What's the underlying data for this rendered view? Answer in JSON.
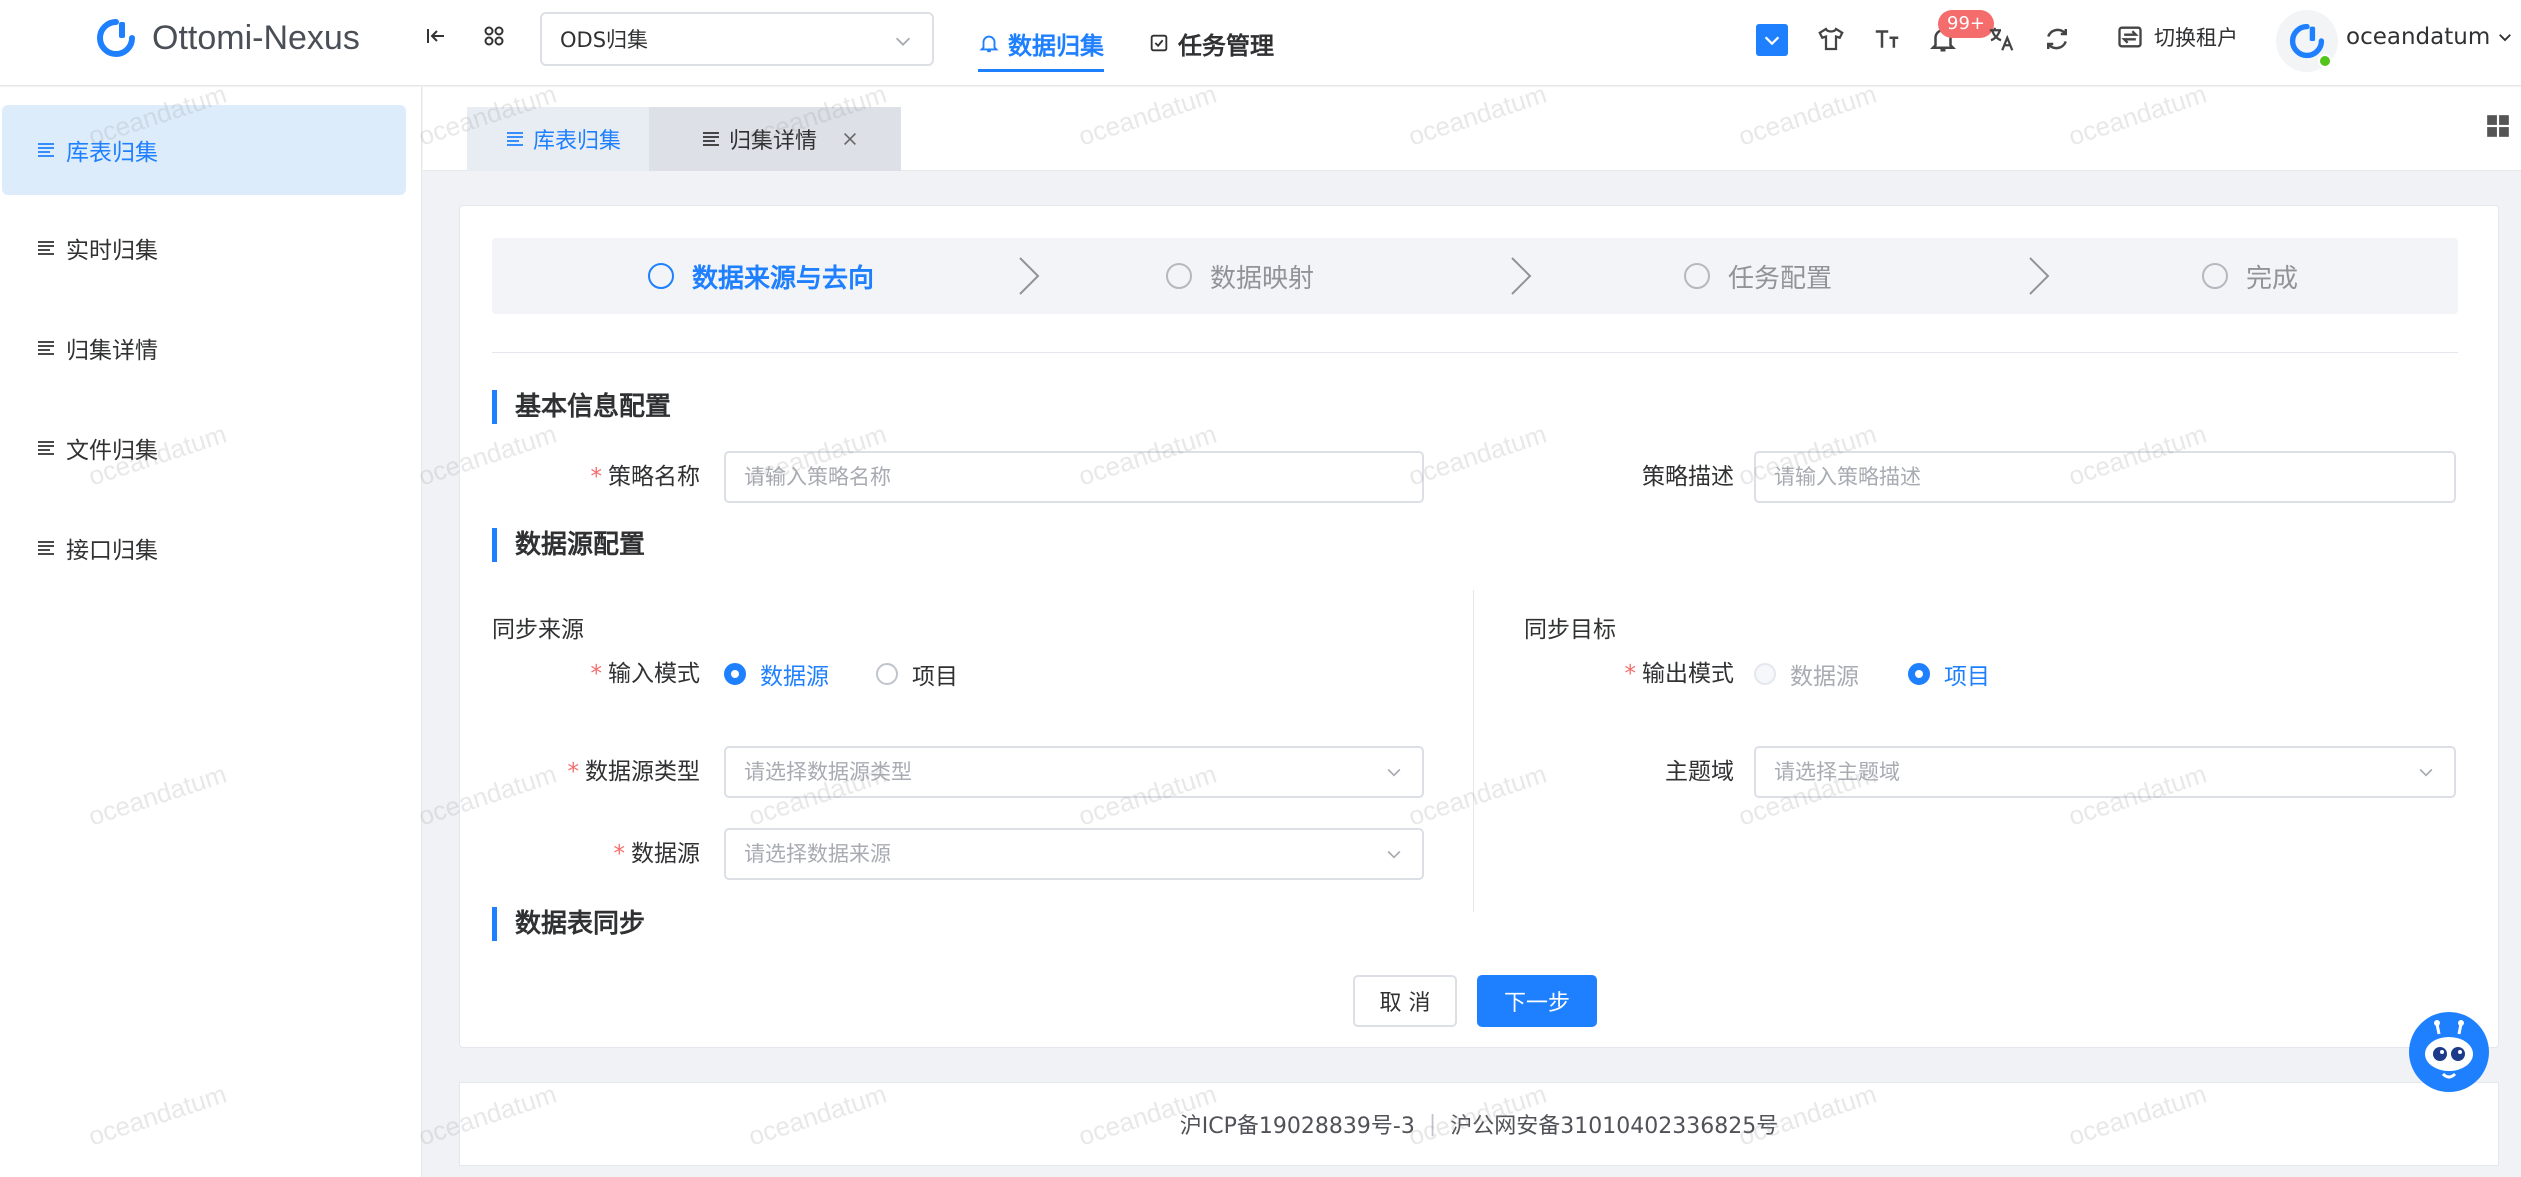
{
  "app": {
    "title": "Ottomi-Nexus"
  },
  "header": {
    "datasource_select": "ODS归集",
    "nav": [
      {
        "label": "数据归集",
        "active": true
      },
      {
        "label": "任务管理",
        "active": false
      }
    ],
    "notification_badge": "99+",
    "tenant_switch": "切换租户",
    "username": "oceandatum"
  },
  "sidebar": {
    "items": [
      {
        "label": "库表归集",
        "active": true
      },
      {
        "label": "实时归集"
      },
      {
        "label": "归集详情"
      },
      {
        "label": "文件归集"
      },
      {
        "label": "接口归集"
      }
    ]
  },
  "tabs": [
    {
      "label": "库表归集",
      "active": true
    },
    {
      "label": "归集详情",
      "closable": true
    }
  ],
  "steps": [
    {
      "label": "数据来源与去向",
      "active": true
    },
    {
      "label": "数据映射"
    },
    {
      "label": "任务配置"
    },
    {
      "label": "完成"
    }
  ],
  "form": {
    "basic_title": "基本信息配置",
    "policy_name_label": "策略名称",
    "policy_name_placeholder": "请输入策略名称",
    "policy_desc_label": "策略描述",
    "policy_desc_placeholder": "请输入策略描述",
    "datasource_title": "数据源配置",
    "source": {
      "title": "同步来源",
      "input_mode_label": "输入模式",
      "options": [
        "数据源",
        "项目"
      ],
      "selected": "数据源",
      "ds_type_label": "数据源类型",
      "ds_type_placeholder": "请选择数据源类型",
      "ds_label": "数据源",
      "ds_placeholder": "请选择数据来源"
    },
    "target": {
      "title": "同步目标",
      "output_mode_label": "输出模式",
      "options": [
        "数据源",
        "项目"
      ],
      "selected": "项目",
      "domain_label": "主题域",
      "domain_placeholder": "请选择主题域"
    },
    "table_sync_title": "数据表同步",
    "cancel_label": "取 消",
    "next_label": "下一步"
  },
  "footer": {
    "icp": "沪ICP备19028839号-3",
    "police": "沪公网安备31010402336825号"
  },
  "watermark": "oceandatum",
  "colors": {
    "primary": "#1e80ff",
    "required": "#f56c6c",
    "active_bg": "#ddecfb"
  }
}
